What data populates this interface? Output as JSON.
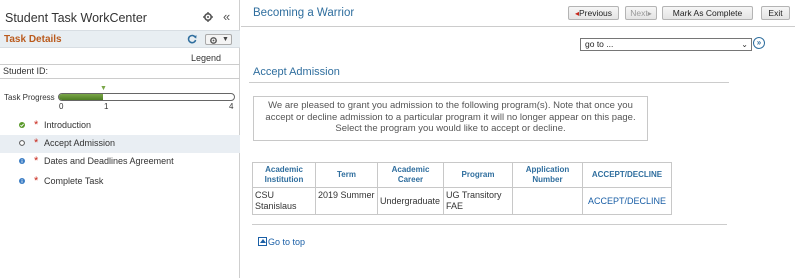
{
  "workcenter": {
    "title": "Student Task WorkCenter",
    "collapse_glyph": "«"
  },
  "task_details": {
    "title": "Task Details",
    "legend": "Legend",
    "student_id_label": "Student ID:"
  },
  "progress": {
    "label": "Task Progress",
    "value": 1,
    "min": 0,
    "max": 4,
    "ticks": [
      "0",
      "1",
      "4"
    ],
    "fill_color": "#6a9a3a"
  },
  "steps": [
    {
      "label": "Introduction",
      "status": "complete",
      "icon": "check-icon",
      "required_mark": "*"
    },
    {
      "label": "Accept Admission",
      "status": "current",
      "icon": "open-circle-icon",
      "required_mark": "*"
    },
    {
      "label": "Dates and Deadlines Agreement",
      "status": "pending",
      "icon": "info-dot-icon",
      "required_mark": "*"
    },
    {
      "label": "Complete Task",
      "status": "pending",
      "icon": "info-dot-icon",
      "required_mark": "*"
    }
  ],
  "header": {
    "page_title": "Becoming a Warrior",
    "previous_label": "Previous",
    "next_label": "Next",
    "mark_complete_label": "Mark As Complete",
    "exit_label": "Exit",
    "goto_value": "go to ...",
    "goto_button_glyph": "»"
  },
  "main": {
    "section_title": "Accept Admission",
    "message": "We are pleased to grant you admission to the following program(s). Note that once you accept or decline admission to a particular program it will no longer appear on this page. Select the program you would like to accept or decline.",
    "table": {
      "headers": [
        "Academic Institution",
        "Term",
        "Academic Career",
        "Program",
        "Application Number",
        "ACCEPT/DECLINE"
      ],
      "rows": [
        {
          "institution": "CSU Stanislaus",
          "term": "2019 Summer",
          "career": "Undergraduate",
          "program": "UG Transitory FAE",
          "application_number": "",
          "action": "ACCEPT/DECLINE"
        }
      ]
    },
    "goto_top": "Go to top"
  },
  "colors": {
    "accent_blue": "#2f6e9e",
    "link_blue": "#1a5fa6",
    "task_title_orange": "#ba5a1c",
    "required_red": "#c8271b",
    "complete_green": "#5a9a2a",
    "pending_blue": "#3b7dc4"
  }
}
